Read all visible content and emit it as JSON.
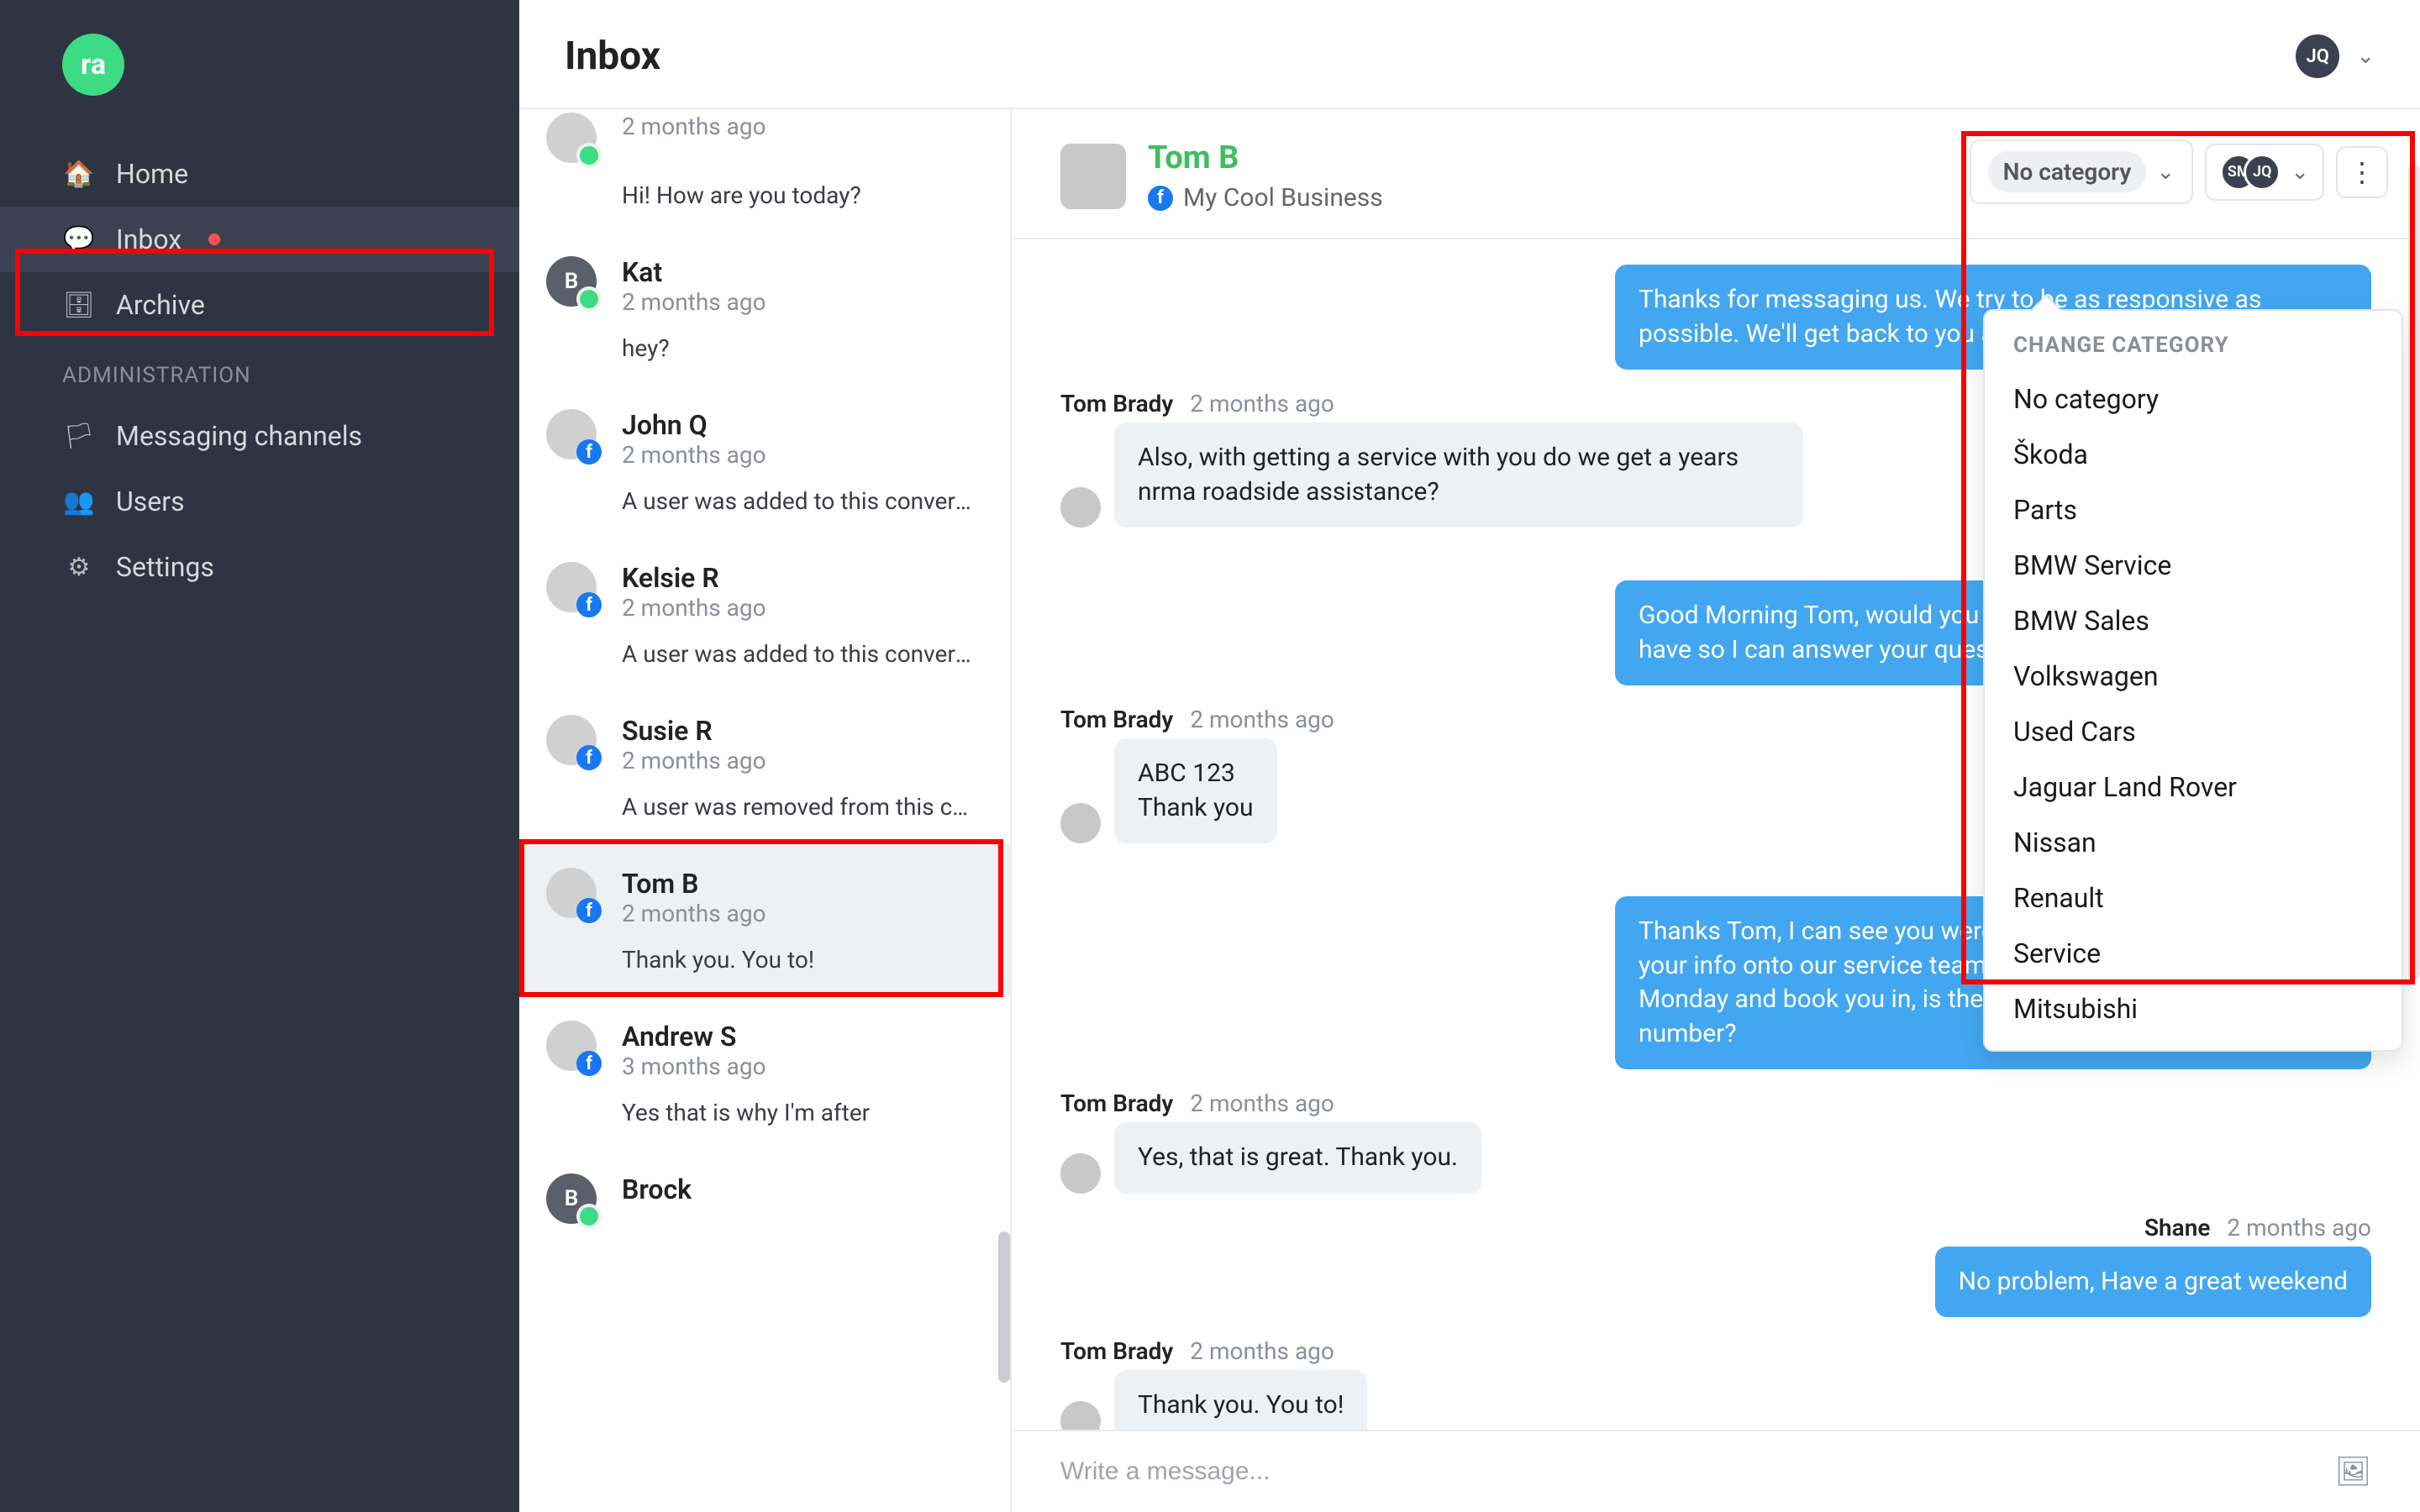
{
  "brand": {
    "logo_text": "ra"
  },
  "header": {
    "title": "Inbox",
    "user_initials": "JQ"
  },
  "nav": {
    "items": [
      {
        "icon": "🏠",
        "label": "Home"
      },
      {
        "icon": "💬",
        "label": "Inbox",
        "has_dot": true,
        "active": true
      },
      {
        "icon": "🗄",
        "label": "Archive"
      }
    ],
    "section_label": "ADMINISTRATION",
    "admin_items": [
      {
        "icon": "🏳",
        "label": "Messaging channels"
      },
      {
        "icon": "👥",
        "label": "Users"
      },
      {
        "icon": "⚙",
        "label": "Settings"
      }
    ]
  },
  "conversations": [
    {
      "name": "",
      "time": "2 months ago",
      "preview": "Hi! How are you today?",
      "unread": true,
      "badge": "online",
      "trunc": true
    },
    {
      "name": "Kat",
      "time": "2 months ago",
      "preview": "hey?",
      "unread": true,
      "badge": "online",
      "letter": "B"
    },
    {
      "name": "John Q",
      "time": "2 months ago",
      "preview": "A user was added to this conversat…",
      "badge": "fb"
    },
    {
      "name": "Kelsie R",
      "time": "2 months ago",
      "preview": "A user was added to this conversat…",
      "badge": "fb"
    },
    {
      "name": "Susie R",
      "time": "2 months ago",
      "preview": "A user was removed from this conv…",
      "badge": "fb"
    },
    {
      "name": "Tom B",
      "time": "2 months ago",
      "preview": "Thank you. You to!",
      "badge": "fb",
      "selected": true
    },
    {
      "name": "Andrew S",
      "time": "3 months ago",
      "preview": "Yes that is why I'm after",
      "badge": "fb"
    },
    {
      "name": "Brock",
      "time": "",
      "preview": "",
      "badge": "online",
      "letter": "B"
    }
  ],
  "thread": {
    "contact_name": "Tom B",
    "channel_name": "My Cool Business",
    "category_label": "No category",
    "assignees": [
      "SM",
      "JQ"
    ],
    "messages": [
      {
        "dir": "out",
        "who": "",
        "when": "",
        "text": "Thanks for messaging us. We try to be as responsive as possible. We'll get back to you as soon as we can."
      },
      {
        "dir": "in",
        "who": "Tom Brady",
        "when": "2 months ago",
        "text": "Also, with getting a service with you do we get a years nrma roadside assistance?"
      },
      {
        "dir": "out",
        "who": "Shane",
        "when": "",
        "text": "Good Morning Tom, would you mind telling me which car you have so I can answer your question better?  Thanks Shane"
      },
      {
        "dir": "in",
        "who": "Tom Brady",
        "when": "2 months ago",
        "text": "ABC 123\nThank you"
      },
      {
        "dir": "out",
        "who": "Shane",
        "when": "",
        "text": "Thanks Tom, I can see you were here last April. I have passed your info onto our service team so that they can call you on Monday and book you in, is the mobile ending in 783 the best number?"
      },
      {
        "dir": "in",
        "who": "Tom Brady",
        "when": "2 months ago",
        "text": "Yes, that is great. Thank you."
      },
      {
        "dir": "out",
        "who": "Shane",
        "when": "2 months ago",
        "text": "No problem, Have a great weekend"
      },
      {
        "dir": "in",
        "who": "Tom Brady",
        "when": "2 months ago",
        "text": "Thank you. You to!"
      }
    ],
    "composer_placeholder": "Write a message..."
  },
  "dropdown": {
    "title": "CHANGE CATEGORY",
    "items": [
      "No category",
      "Škoda",
      "Parts",
      "BMW Service",
      "BMW Sales",
      "Volkswagen",
      "Used Cars",
      "Jaguar Land Rover",
      "Nissan",
      "Renault",
      "Service",
      "Mitsubishi"
    ]
  }
}
